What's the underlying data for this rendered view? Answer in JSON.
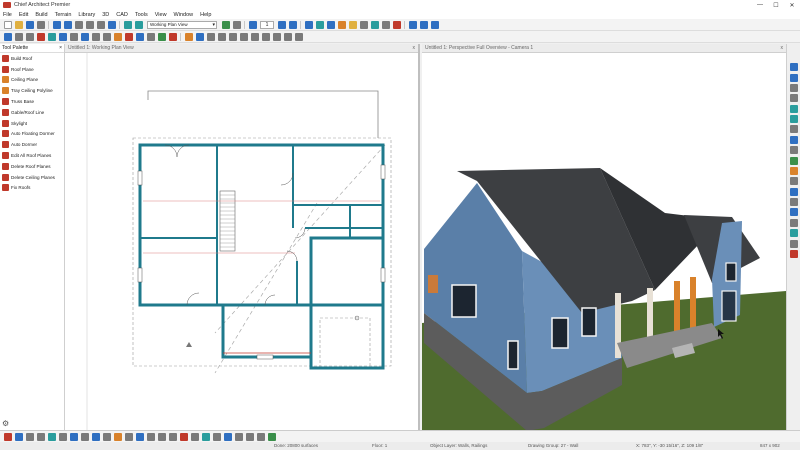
{
  "window": {
    "title": "Chief Architect Premier",
    "minimize": "—",
    "maximize": "☐",
    "close": "✕"
  },
  "menu": [
    "File",
    "Edit",
    "Build",
    "Terrain",
    "Library",
    "3D",
    "CAD",
    "Tools",
    "View",
    "Window",
    "Help"
  ],
  "toolbar": {
    "view_select": "Working Plan View",
    "floor_number": "1"
  },
  "tool_palette": {
    "title": "Tool Palette",
    "items": [
      "Build Roof",
      "Roof Plane",
      "Ceiling Plane",
      "Tray Ceiling Polyline",
      "Truss Base",
      "Gable/Roof Line",
      "Skylight",
      "Auto Floating Dormer",
      "Auto Dormer",
      "Edit All Roof Planes",
      "Delete Roof Planes",
      "Delete Ceiling Planes",
      "Fix Roofs"
    ]
  },
  "plan_view": {
    "tab_label": "Untitled 1: Working Plan View",
    "close": "x"
  },
  "perspective_view": {
    "tab_label": "Untitled 1: Perspective Full Overview - Camera 1",
    "close": "x"
  },
  "status": {
    "done": "Done: 20800 surfaces",
    "floor": "Floor: 1",
    "layer": "Object Layer: Walls, Railings",
    "group": "Drawing Group: 27 - Wall",
    "coords": "X: 783\", Y: -30 15/16\", Z: 109 1/8\"",
    "size": "847 x 902"
  },
  "icon_colors": {
    "blue": "#2f6fc1",
    "red": "#c0392b",
    "grey": "#7a7a7a",
    "green": "#3a8f4a",
    "orange": "#d9822b",
    "teal": "#2a9d9d"
  }
}
